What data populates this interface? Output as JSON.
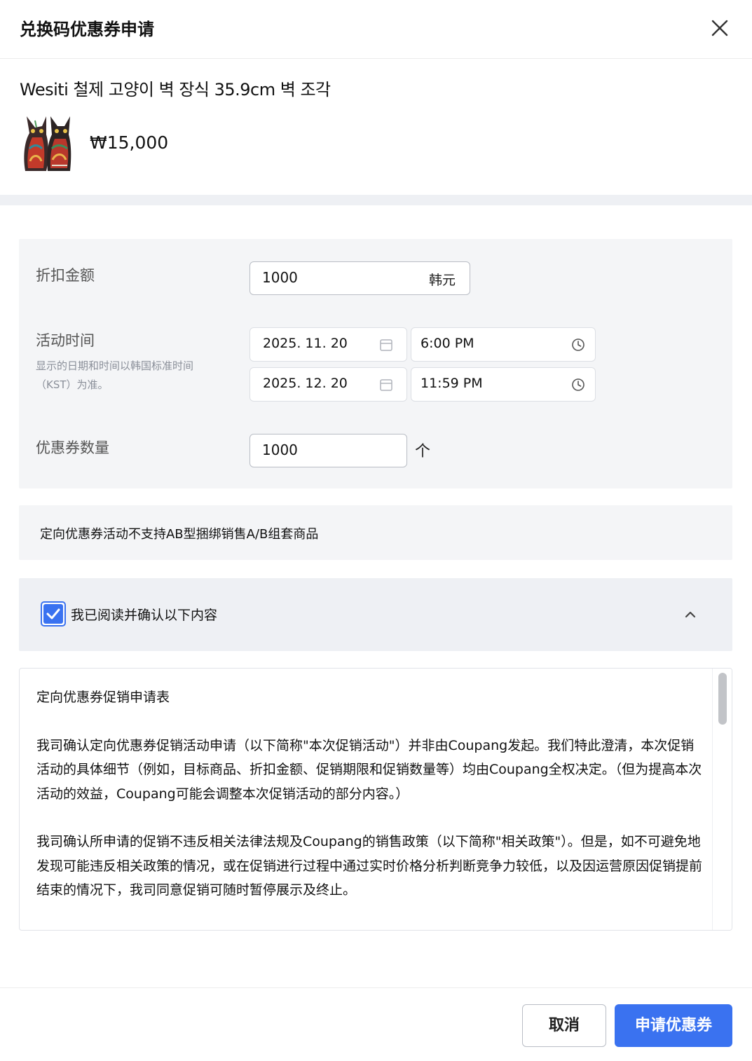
{
  "modal": {
    "title": "兑换码优惠券申请",
    "close_icon": "close-icon"
  },
  "product": {
    "name": "Wesiti 철제 고양이 벽 장식 35.9cm 벽 조각",
    "price": "₩15,000",
    "thumbnail_icon": "cat-wall-decor-thumbnail"
  },
  "form": {
    "discount": {
      "label": "折扣金额",
      "value": "1000",
      "suffix": "韩元"
    },
    "period": {
      "label": "活动时间",
      "note": "显示的日期和时间以韩国标准时间（KST）为准。",
      "start_date": "2025. 11. 20",
      "start_time": "6:00 PM",
      "end_date": "2025. 12. 20",
      "end_time": "11:59 PM",
      "date_icon": "calendar-icon",
      "time_icon": "clock-icon"
    },
    "quantity": {
      "label": "优惠券数量",
      "value": "1000",
      "unit": "个"
    }
  },
  "notice": {
    "text": "定向优惠券活动不支持AB型捆绑销售A/B组套商品"
  },
  "agreement": {
    "checked": true,
    "label": "我已阅读并确认以下内容",
    "chevron_icon": "chevron-up-icon"
  },
  "terms": {
    "title": "定向优惠券促销申请表",
    "paragraphs": [
      "我司确认定向优惠券促销活动申请（以下简称\"本次促销活动\"）并非由Coupang发起。我们特此澄清，本次促销活动的具体细节（例如，目标商品、折扣金额、促销期限和促销数量等）均由Coupang全权决定。（但为提高本次活动的效益，Coupang可能会调整本次促销活动的部分内容。）",
      "我司确认所申请的促销不违反相关法律法规及Coupang的销售政策（以下简称\"相关政策\"）。但是，如不可避免地发现可能违反相关政策的情况，或在促销进行过程中通过实时价格分析判断竞争力较低，以及因运营原因促销提前结束的情况下，我司同意促销可随时暂停展示及终止。"
    ]
  },
  "footer": {
    "cancel_label": "取消",
    "submit_label": "申请优惠券",
    "accent_color": "#3a72f0"
  }
}
